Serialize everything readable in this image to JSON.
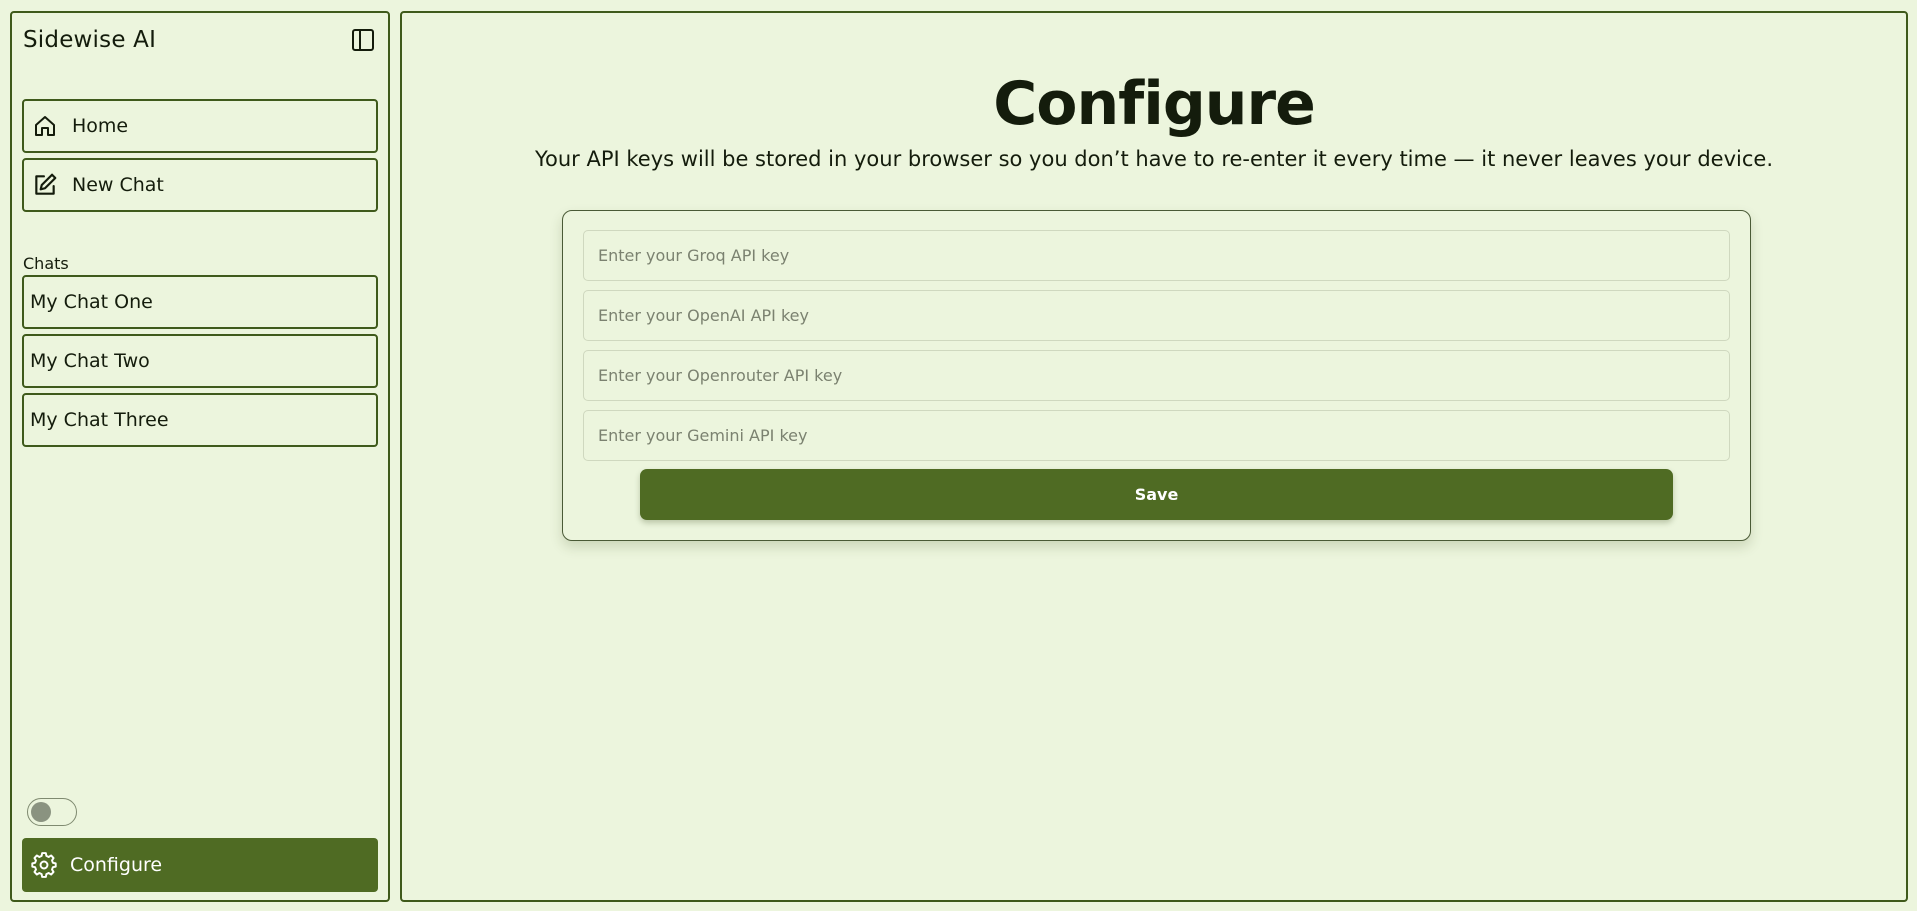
{
  "app": {
    "title": "Sidewise AI"
  },
  "sidebar": {
    "nav": [
      {
        "label": "Home",
        "icon": "home-icon"
      },
      {
        "label": "New Chat",
        "icon": "edit-icon"
      }
    ],
    "chats_heading": "Chats",
    "chats": [
      {
        "label": "My Chat One"
      },
      {
        "label": "My Chat Two"
      },
      {
        "label": "My Chat Three"
      }
    ],
    "theme_toggle": {
      "on": false
    },
    "configure": {
      "label": "Configure",
      "icon": "gear-icon"
    }
  },
  "main": {
    "title": "Configure",
    "subtitle": "Your API keys will be stored in your browser so you don’t have to re-enter it every time — it never leaves your device.",
    "inputs": [
      {
        "placeholder": "Enter your Groq API key",
        "value": ""
      },
      {
        "placeholder": "Enter your OpenAI API key",
        "value": ""
      },
      {
        "placeholder": "Enter your Openrouter API key",
        "value": ""
      },
      {
        "placeholder": "Enter your Gemini API key",
        "value": ""
      }
    ],
    "save_label": "Save"
  },
  "colors": {
    "background": "#ecf5dd",
    "border": "#3f5a1b",
    "accent": "#4f6b23",
    "text": "#141c0c"
  }
}
